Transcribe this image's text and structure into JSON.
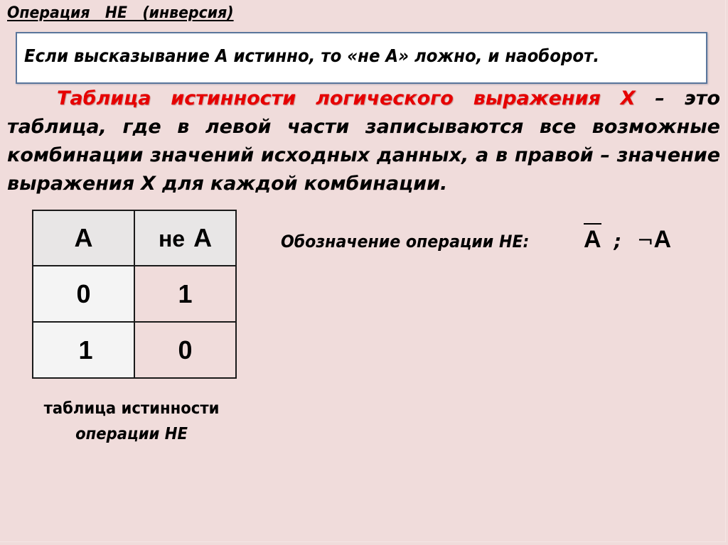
{
  "slide": {
    "title": "Операция   НЕ   (инверсия)",
    "definition_box": "Если высказывание А истинно, то «не А» ложно, и наоборот.",
    "paragraph": {
      "lines": [
        {
          "red_words": [
            "Таблица",
            "истинности",
            "логического",
            "выражения",
            "Х"
          ],
          "black_words": [
            "–",
            "это"
          ]
        },
        {
          "words": [
            "таблица,",
            "где",
            "в",
            "левой",
            "части",
            "записываются",
            "все",
            "возможные"
          ]
        },
        {
          "words": [
            "комбинации",
            "значений",
            "исходных",
            "данных,",
            "а",
            "в",
            "правой",
            "–",
            "значение"
          ]
        },
        {
          "words": [
            "выражения",
            "Х",
            "для",
            "каждой",
            "комбинации."
          ]
        }
      ]
    },
    "truth_table": {
      "headers": [
        "А",
        "не",
        "А"
      ],
      "header_labels": {
        "a": "А",
        "not_a_prefix": "не",
        "not_a_var": "А"
      },
      "rows": [
        {
          "a": "0",
          "not_a": "1"
        },
        {
          "a": "1",
          "not_a": "0"
        }
      ]
    },
    "caption": {
      "line1": "таблица  истинности",
      "line2": "операции НЕ"
    },
    "notation": {
      "label": "Обозначение  операции  НЕ:",
      "symbol_overline": "А",
      "separator": ";",
      "negation_sign": "¬",
      "symbol_negation": "А"
    },
    "colors": {
      "background": "#f0dcdb",
      "accent_red": "#e60000",
      "box_border": "#5a769c",
      "table_header": "#e8e6e6"
    }
  }
}
